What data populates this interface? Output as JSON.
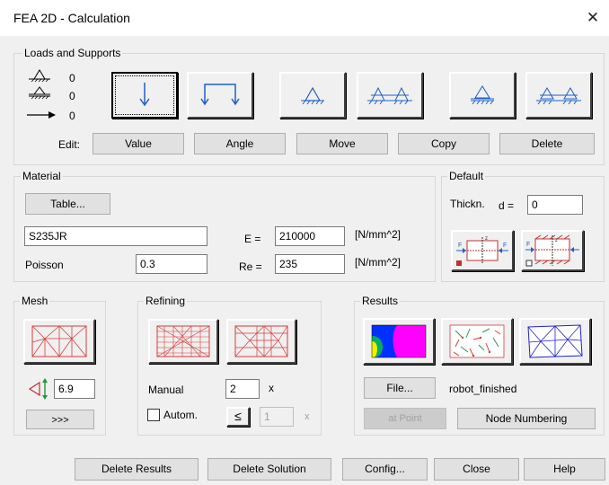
{
  "window": {
    "title": "FEA 2D - Calculation",
    "close": "✕"
  },
  "loads": {
    "label": "Loads and Supports",
    "counts": [
      "0",
      "0",
      "0"
    ],
    "edit_label": "Edit:",
    "buttons": [
      "Value",
      "Angle",
      "Move",
      "Copy",
      "Delete"
    ]
  },
  "material": {
    "label": "Material",
    "table_button": "Table...",
    "name": "S235JR",
    "poisson_label": "Poisson",
    "poisson": "0.3",
    "e_label": "E =",
    "e_value": "210000",
    "e_unit": "[N/mm^2]",
    "re_label": "Re =",
    "re_value": "235",
    "re_unit": "[N/mm^2]"
  },
  "default": {
    "label": "Default",
    "thickness_label": "Thickn.",
    "d_label": "d =",
    "d_value": "0",
    "f_letter": "F",
    "z_letter": "z"
  },
  "mesh": {
    "label": "Mesh",
    "size": "6.9",
    "more_button": ">>>"
  },
  "refining": {
    "label": "Refining",
    "manual_label": "Manual",
    "manual_value": "2",
    "times": "x",
    "autom_label": "Autom.",
    "le_symbol": "≤",
    "autom_value": "1",
    "autom_times": "x"
  },
  "results": {
    "label": "Results",
    "file_button": "File...",
    "file_name": "robot_finished",
    "at_point_button": "at Point",
    "node_numbering_button": "Node Numbering"
  },
  "footer": {
    "buttons": [
      "Delete Results",
      "Delete Solution",
      "Config...",
      "Close",
      "Help"
    ]
  },
  "colors": {
    "mesh_red": "#d63b3b",
    "mesh_blue": "#2222cc",
    "stress_magenta": "#ff00ff",
    "stress_blue": "#0030ff",
    "stress_green": "#00b060",
    "stress_yellow": "#f0f000"
  }
}
